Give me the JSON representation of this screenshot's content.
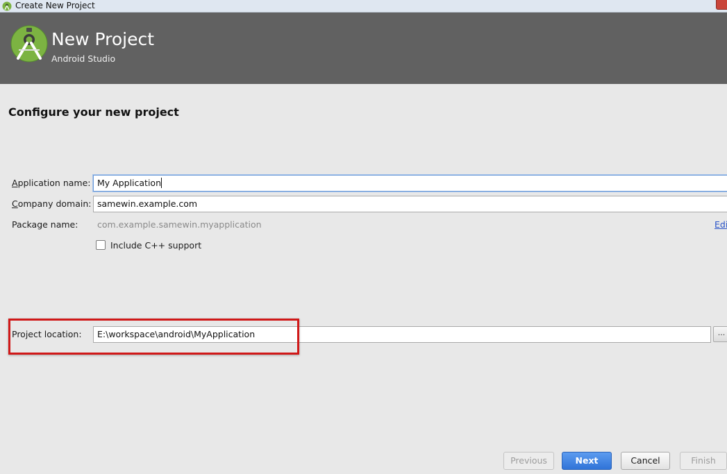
{
  "window": {
    "title": "Create New Project",
    "icon": "android-studio-icon"
  },
  "header": {
    "title": "New Project",
    "subtitle": "Android Studio",
    "logo": "android-studio-logo"
  },
  "section_title": "Configure your new project",
  "form": {
    "app_name": {
      "label_first": "A",
      "label_rest": "pplication name:",
      "value": "My Application"
    },
    "company_domain": {
      "label_first": "C",
      "label_rest": "ompany domain:",
      "value": "samewin.example.com"
    },
    "package_name": {
      "label": "Package name:",
      "value": "com.example.samewin.myapplication",
      "edit_link": "Edit"
    },
    "cpp_support": {
      "label": "Include C++ support",
      "checked": false
    },
    "project_location": {
      "label": "Project location:",
      "value": "E:\\workspace\\android\\MyApplication",
      "browse": "..."
    }
  },
  "highlight_color": "#d01818",
  "buttons": {
    "previous": "Previous",
    "next": "Next",
    "cancel": "Cancel",
    "finish": "Finish"
  },
  "colors": {
    "header_bg": "#616161",
    "primary_button": "#2f73d8",
    "link": "#2a54c9"
  }
}
